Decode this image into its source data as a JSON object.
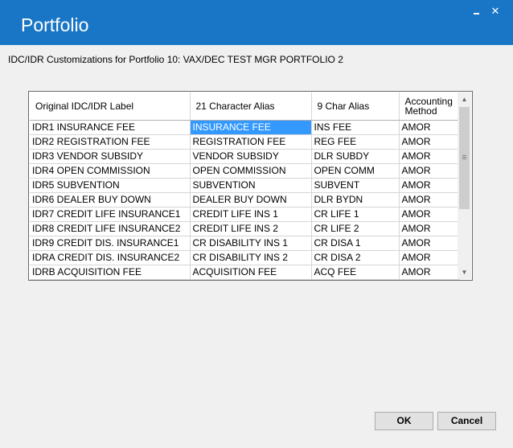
{
  "window": {
    "title": "Portfolio",
    "minimize_glyph": "_",
    "close_glyph": "✕"
  },
  "header": {
    "section_label": "IDC/IDR Customizations",
    "portfolio_label": "for Portfolio 10: VAX/DEC TEST MGR PORTFOLIO 2"
  },
  "grid": {
    "columns": [
      {
        "label": "Original IDC/IDR Label"
      },
      {
        "label": "21 Character Alias"
      },
      {
        "label": "9 Char Alias"
      },
      {
        "label": "Accounting Method"
      }
    ],
    "rows": [
      [
        "IDR1 INSURANCE FEE",
        "INSURANCE FEE",
        "INS FEE",
        "AMOR"
      ],
      [
        "IDR2 REGISTRATION FEE",
        "REGISTRATION FEE",
        "REG FEE",
        "AMOR"
      ],
      [
        "IDR3 VENDOR SUBSIDY",
        "VENDOR SUBSIDY",
        "DLR SUBDY",
        "AMOR"
      ],
      [
        "IDR4 OPEN COMMISSION",
        "OPEN COMMISSION",
        "OPEN COMM",
        "AMOR"
      ],
      [
        "IDR5 SUBVENTION",
        "SUBVENTION",
        "SUBVENT",
        "AMOR"
      ],
      [
        "IDR6 DEALER BUY DOWN",
        "DEALER BUY DOWN",
        "DLR BYDN",
        "AMOR"
      ],
      [
        "IDR7 CREDIT LIFE INSURANCE1",
        "CREDIT LIFE INS 1",
        "CR LIFE 1",
        "AMOR"
      ],
      [
        "IDR8 CREDIT LIFE INSURANCE2",
        "CREDIT LIFE INS 2",
        "CR LIFE 2",
        "AMOR"
      ],
      [
        "IDR9 CREDIT DIS. INSURANCE1",
        "CR DISABILITY INS 1",
        "CR DISA 1",
        "AMOR"
      ],
      [
        "IDRA CREDIT DIS. INSURANCE2",
        "CR DISABILITY INS 2",
        "CR DISA 2",
        "AMOR"
      ],
      [
        "IDRB ACQUISITION FEE",
        "ACQUISITION FEE",
        "ACQ FEE",
        "AMOR"
      ]
    ],
    "selected_cell": {
      "row": 0,
      "col": 1
    },
    "scroll_up_glyph": "▲",
    "scroll_down_glyph": "▼"
  },
  "buttons": {
    "ok": "OK",
    "cancel": "Cancel"
  },
  "colors": {
    "titlebar": "#1976c6",
    "selection": "#3399ff"
  }
}
